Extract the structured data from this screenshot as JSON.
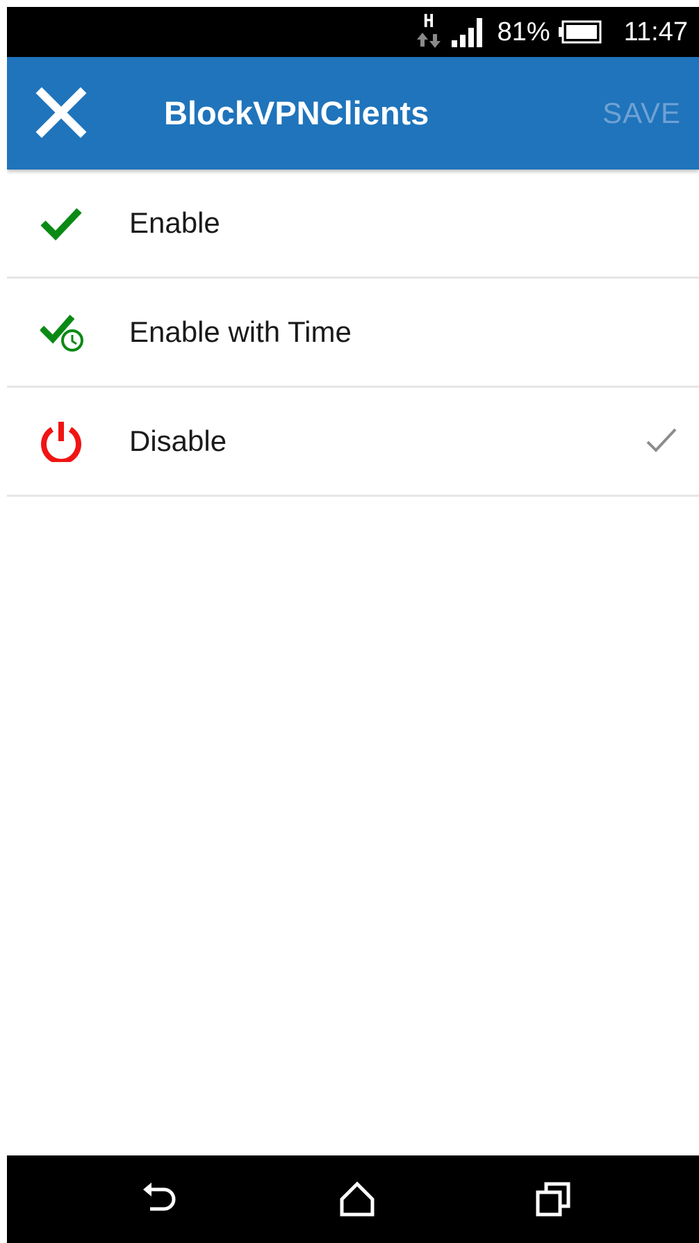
{
  "status_bar": {
    "network_type": "H",
    "battery_percent": "81%",
    "time": "11:47"
  },
  "app_bar": {
    "title": "BlockVPNClients",
    "save_label": "SAVE"
  },
  "options": [
    {
      "label": "Enable",
      "icon": "green-check-icon",
      "selected": false
    },
    {
      "label": "Enable with Time",
      "icon": "check-clock-icon",
      "selected": false
    },
    {
      "label": "Disable",
      "icon": "power-icon",
      "selected": true
    }
  ],
  "colors": {
    "app_bar": "#1f74bb",
    "save_disabled": "#6fa1d4",
    "enable_green": "#0a8a14",
    "disable_red": "#f01414",
    "divider": "#e6e6e6"
  }
}
